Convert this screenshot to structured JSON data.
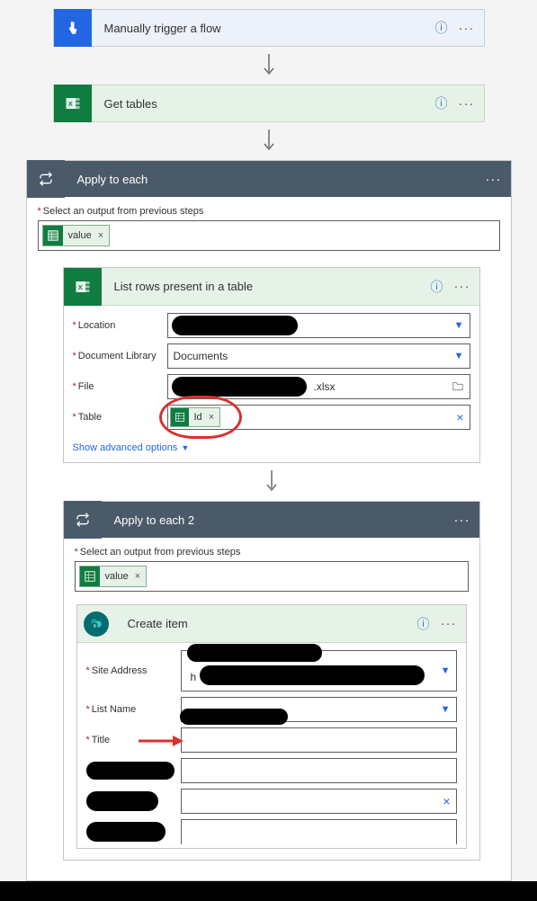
{
  "trigger": {
    "title": "Manually trigger a flow"
  },
  "get_tables": {
    "title": "Get tables"
  },
  "apply1": {
    "title": "Apply to each",
    "select_label": "Select an output from previous steps",
    "token": "value"
  },
  "list_rows": {
    "title": "List rows present in a table",
    "location_label": "Location",
    "doclib_label": "Document Library",
    "doclib_value": "Documents",
    "file_label": "File",
    "file_suffix": ".xlsx",
    "table_label": "Table",
    "table_token": "Id",
    "show_adv": "Show advanced options"
  },
  "apply2": {
    "title": "Apply to each 2",
    "select_label": "Select an output from previous steps",
    "token": "value"
  },
  "create_item": {
    "title": "Create item",
    "site_label": "Site Address",
    "site_prefix": "h",
    "list_label": "List Name",
    "title_label": "Title"
  },
  "chart_data": null
}
